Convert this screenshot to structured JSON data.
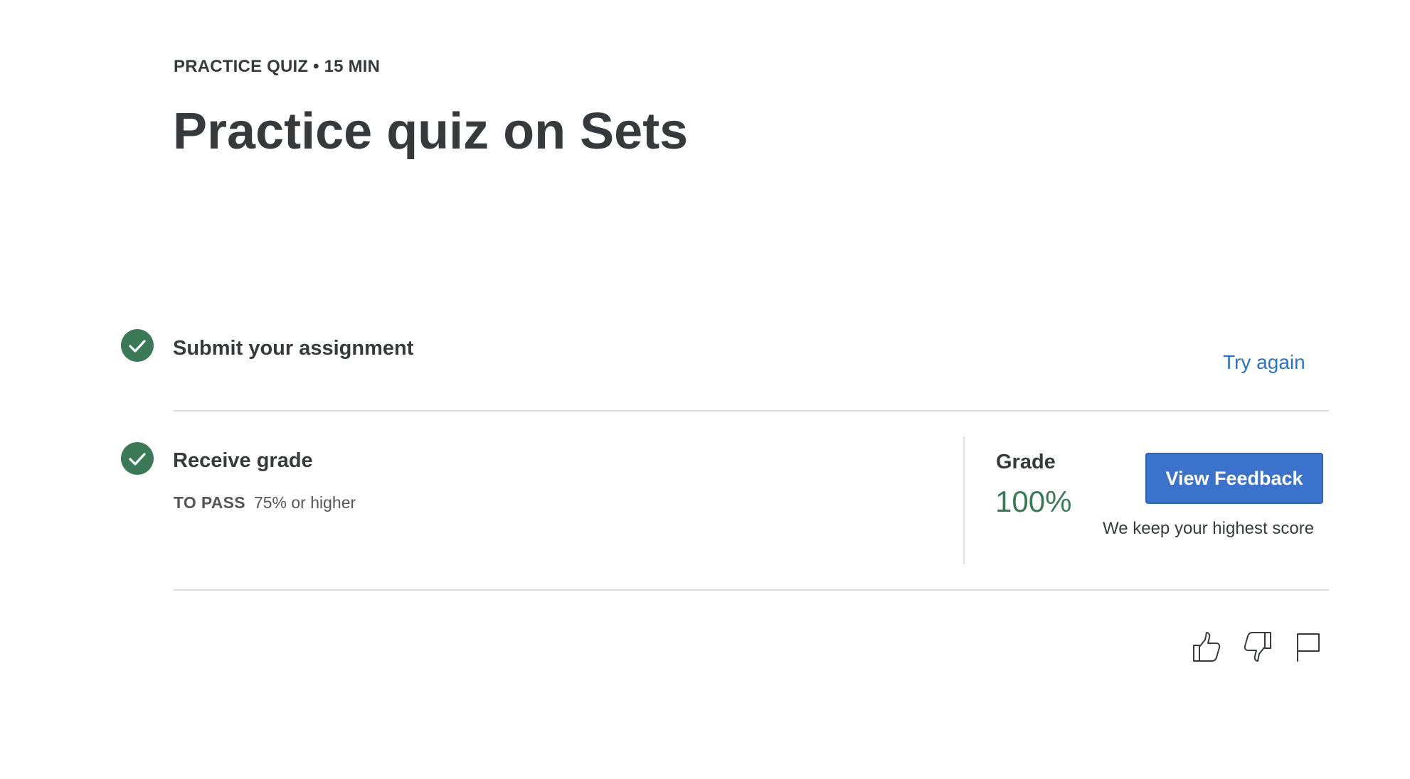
{
  "header": {
    "eyebrow": "PRACTICE QUIZ • 15 MIN",
    "title": "Practice quiz on Sets"
  },
  "steps": {
    "submit": {
      "title": "Submit your assignment",
      "status_icon": "check-circle-icon",
      "action_label": "Try again"
    },
    "grade": {
      "title": "Receive grade",
      "status_icon": "check-circle-icon",
      "pass_key": "TO PASS",
      "pass_value": "75% or higher"
    }
  },
  "grade_panel": {
    "label": "Grade",
    "value": "100%",
    "button_label": "View Feedback",
    "note": "We keep your highest score"
  },
  "feedback_icons": [
    "thumbs-up-icon",
    "thumbs-down-icon",
    "flag-icon"
  ],
  "colors": {
    "accent_blue": "#3b73cc",
    "link_blue": "#2a73cc",
    "success_green": "#3b7a57",
    "text": "#373a3c"
  }
}
